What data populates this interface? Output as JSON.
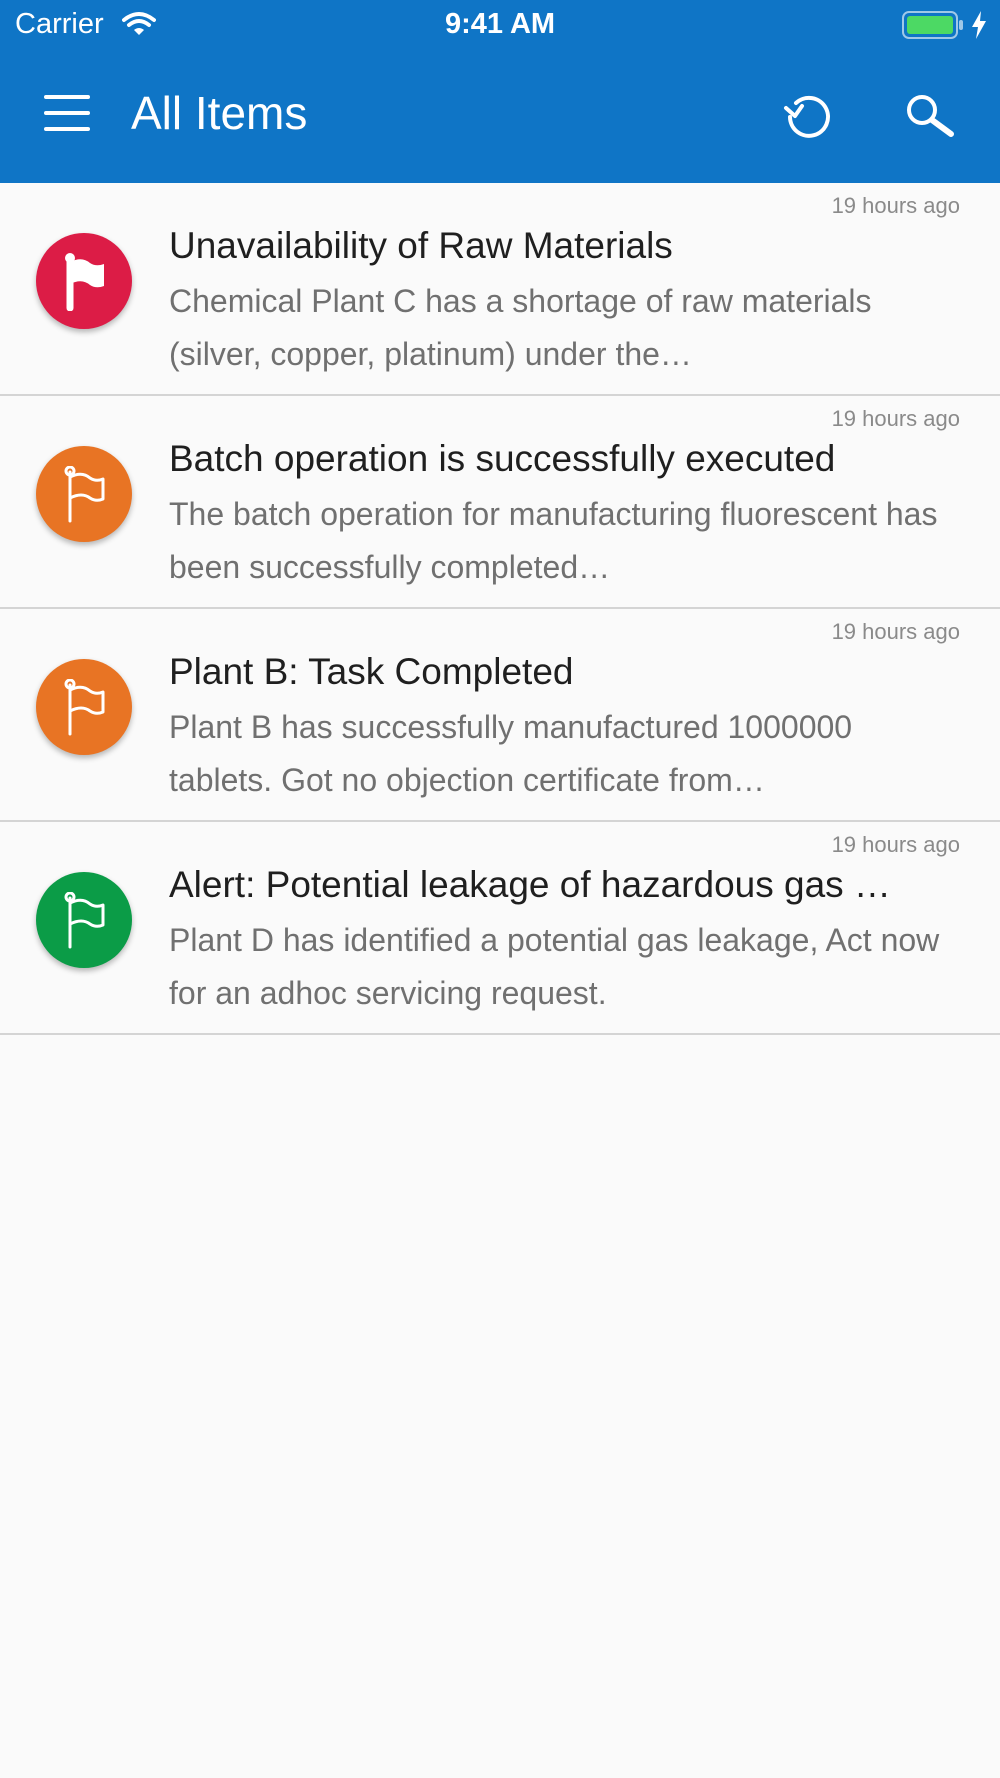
{
  "status_bar": {
    "carrier": "Carrier",
    "time": "9:41 AM",
    "wifi_icon": "wifi-icon",
    "battery_icon": "battery-icon",
    "charging_icon": "charging-bolt-icon"
  },
  "app_bar": {
    "menu_icon": "hamburger-menu-icon",
    "title": "All Items",
    "refresh_icon": "refresh-icon",
    "search_icon": "search-icon",
    "color": "#0f75c6"
  },
  "items": [
    {
      "timestamp": "19 hours ago",
      "title": "Unavailability of Raw Materials",
      "description": "Chemical Plant C has a shortage of raw materials (silver, copper, platinum) under the…",
      "icon": "flag-filled-icon",
      "color": "#dc1c46"
    },
    {
      "timestamp": "19 hours ago",
      "title": "Batch operation is successfully executed",
      "description": "The batch operation for manufacturing fluorescent has been successfully completed…",
      "icon": "flag-outline-icon",
      "color": "#e87424"
    },
    {
      "timestamp": "19 hours ago",
      "title": "Plant B: Task Completed",
      "description": "Plant B has successfully manufactured 1000000 tablets. Got no objection certificate from…",
      "icon": "flag-outline-icon",
      "color": "#e87424"
    },
    {
      "timestamp": "19 hours ago",
      "title": "Alert: Potential leakage of hazardous gas …",
      "description": "Plant D has identified a potential gas leakage, Act now for an adhoc servicing request.",
      "icon": "flag-outline-icon",
      "color": "#0b9c47"
    }
  ]
}
